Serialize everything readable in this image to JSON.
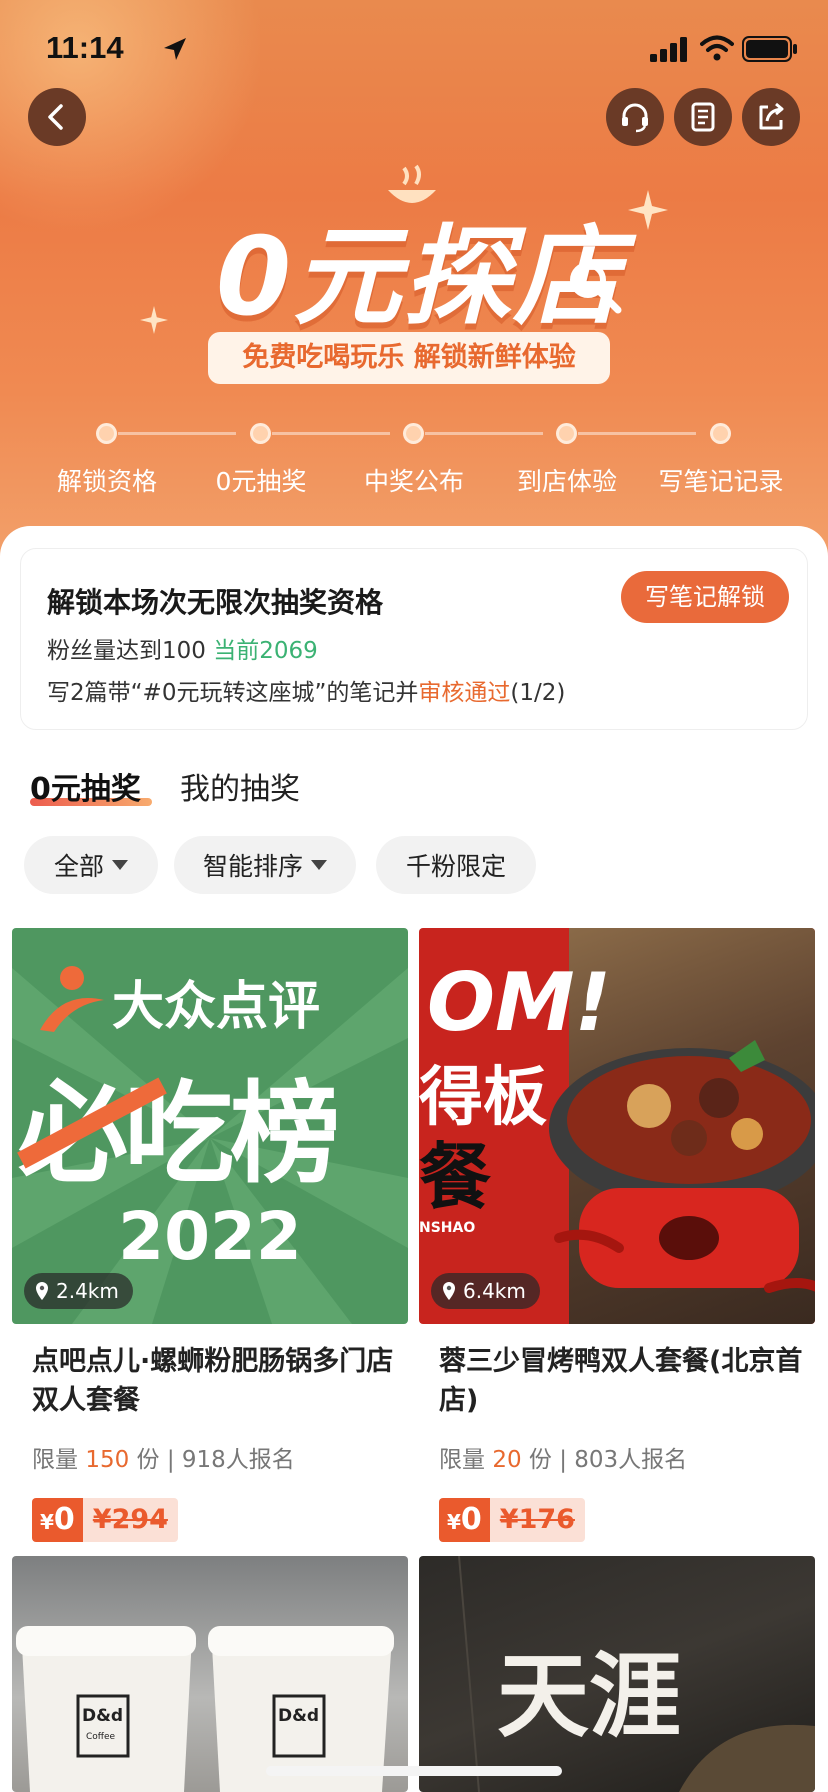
{
  "status_bar": {
    "time": "11:14"
  },
  "hero": {
    "title": "0元探店",
    "slogan": "免费吃喝玩乐 解锁新鲜体验",
    "steps": [
      "解锁资格",
      "0元抽奖",
      "中奖公布",
      "到店体验",
      "写笔记记录"
    ]
  },
  "unlock": {
    "title": "解锁本场次无限次抽奖资格",
    "button": "写笔记解锁",
    "fans_label": "粉丝量达到100",
    "fans_current": "当前2069",
    "notes_prefix": "写2篇带“#0元玩转这座城”的笔记并",
    "notes_status": "审核通过",
    "notes_progress": "(1/2)"
  },
  "tabs": [
    "0元抽奖",
    "我的抽奖"
  ],
  "filters": [
    "全部",
    "智能排序",
    "千粉限定"
  ],
  "products": [
    {
      "distance": "2.4km",
      "image_text": {
        "brand": "大众点评",
        "main": "必吃榜",
        "year": "2022"
      },
      "title": "点吧点儿·螺蛳粉肥肠锅多门店双人套餐",
      "meta_prefix": "限量",
      "limit": "150",
      "meta_suffix": "份 | 918人报名",
      "price_now_symbol": "¥",
      "price_now": "0",
      "price_old": "¥294"
    },
    {
      "distance": "6.4km",
      "image_text": {
        "top": "OM!",
        "mid": "得板",
        "low": "餐",
        "tag": "NSHAO"
      },
      "title": "蓉三少冒烤鸭双人套餐(北京首店)",
      "meta_prefix": "限量",
      "limit": "20",
      "meta_suffix": "份 | 803人报名",
      "price_now_symbol": "¥",
      "price_now": "0",
      "price_old": "¥176"
    },
    {
      "image_text": {
        "cup1": "D&d",
        "cup2": "D&d",
        "cup_sub": "Coffee"
      }
    },
    {
      "image_text": {
        "big": "天涯"
      }
    }
  ],
  "colors": {
    "accent": "#e96a3b",
    "green": "#3bb273",
    "hero_top": "#e98a4e"
  }
}
